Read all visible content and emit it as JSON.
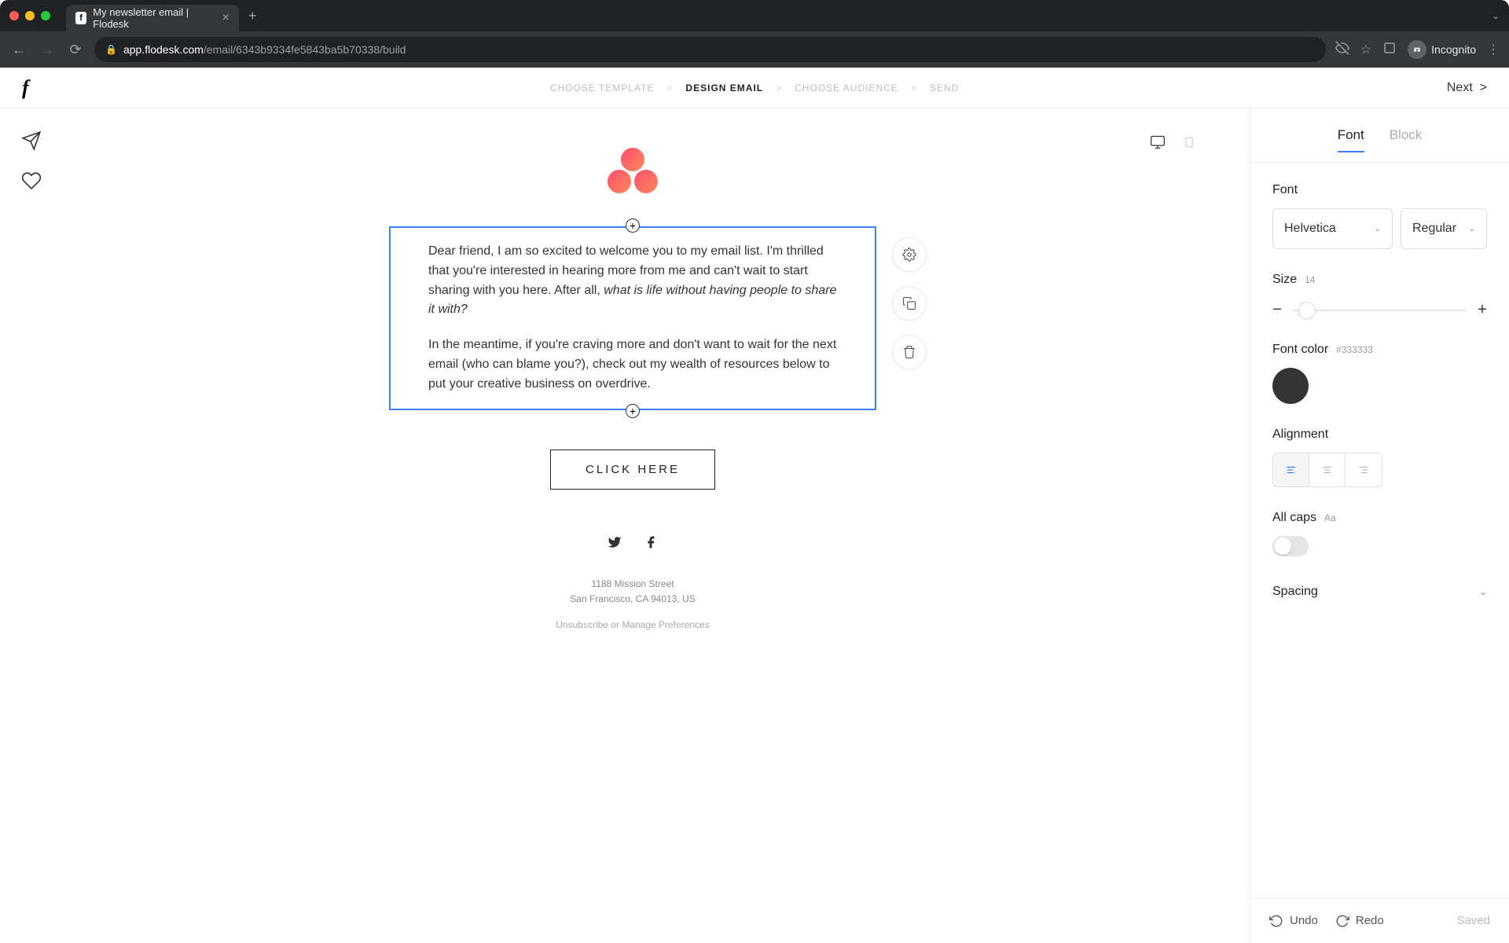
{
  "browser": {
    "tab_title": "My newsletter email | Flodesk",
    "url_domain": "app.flodesk.com",
    "url_path": "/email/6343b9334fe5843ba5b70338/build",
    "incognito_label": "Incognito"
  },
  "header": {
    "steps": [
      "CHOOSE TEMPLATE",
      "DESIGN EMAIL",
      "CHOOSE AUDIENCE",
      "SEND"
    ],
    "active_step_index": 1,
    "next_label": "Next"
  },
  "email": {
    "paragraph1_lead": "Dear friend, I am so excited to welcome you to my email list. I'm thrilled that you're interested in hearing more from me and can't wait to start sharing with you here. After all, ",
    "paragraph1_italic": "what is life without having people to share it with?",
    "paragraph2": "In the meantime, if you're craving more and don't want to wait for the next email (who can blame you?), check out my wealth of resources below to put your creative business on overdrive.",
    "cta_label": "CLICK HERE",
    "address_line1": "1188 Mission Street",
    "address_line2": "San Francisco, CA 94013, US",
    "unsubscribe_label": "Unsubscribe",
    "or_label": " or ",
    "manage_label": "Manage Preferences"
  },
  "panel": {
    "tabs": [
      "Font",
      "Block"
    ],
    "active_tab_index": 0,
    "font_section_label": "Font",
    "font_family": "Helvetica",
    "font_weight": "Regular",
    "size_label": "Size",
    "size_value": "14",
    "color_label": "Font color",
    "color_value": "#333333",
    "alignment_label": "Alignment",
    "allcaps_label": "All caps",
    "allcaps_hint": "Aa",
    "spacing_label": "Spacing"
  },
  "footer": {
    "undo_label": "Undo",
    "redo_label": "Redo",
    "saved_label": "Saved"
  }
}
